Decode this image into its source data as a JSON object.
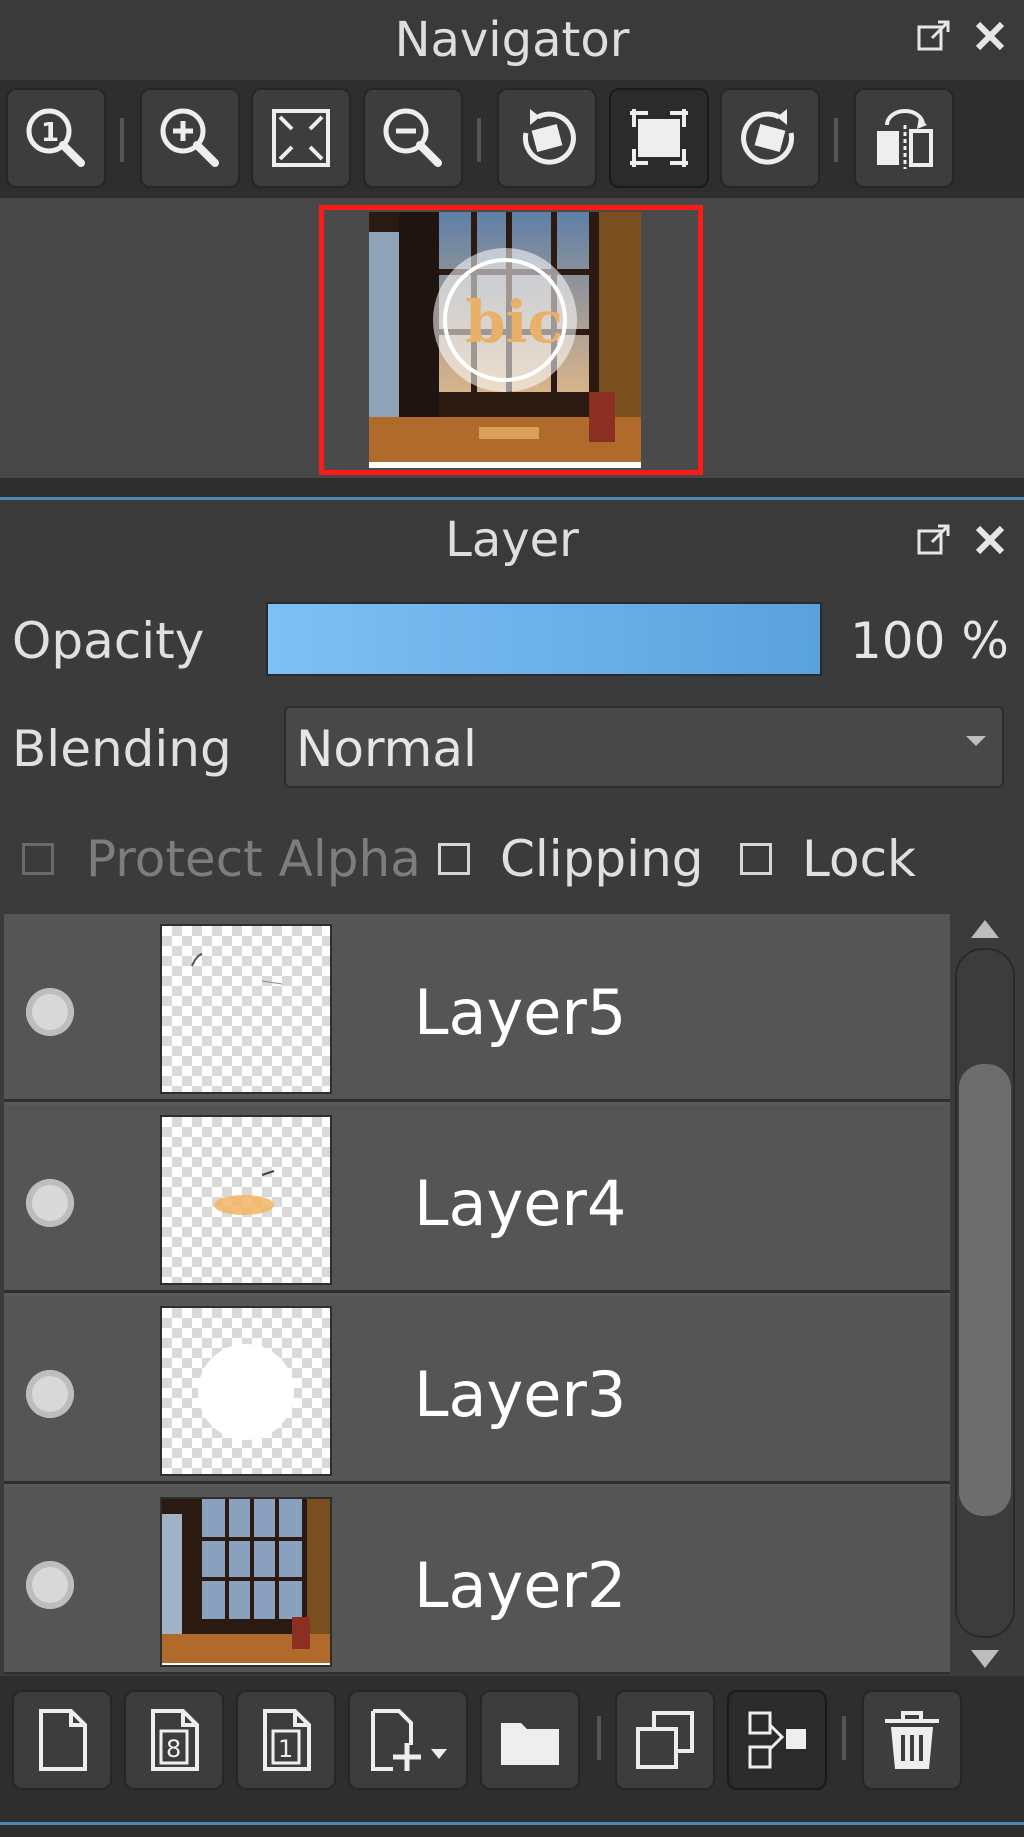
{
  "navigator": {
    "title": "Navigator",
    "toolbar": [
      "zoom-actual-icon",
      "zoom-in-icon",
      "fit-screen-icon",
      "zoom-out-icon",
      "rotate-left-icon",
      "fit-canvas-icon",
      "rotate-right-icon",
      "flip-horizontal-icon"
    ],
    "preview_text": "bic"
  },
  "layer_panel": {
    "title": "Layer",
    "opacity_label": "Opacity",
    "opacity_value": "100 %",
    "opacity_fraction": 1.0,
    "blending_label": "Blending",
    "blending_value": "Normal",
    "protect_alpha_label": "Protect Alpha",
    "clipping_label": "Clipping",
    "lock_label": "Lock",
    "layers": [
      {
        "name": "Layer5"
      },
      {
        "name": "Layer4"
      },
      {
        "name": "Layer3"
      },
      {
        "name": "Layer2"
      }
    ],
    "toolbar": [
      "new-layer-icon",
      "new-8bit-layer-icon",
      "new-1bit-layer-icon",
      "add-layer-menu-icon",
      "folder-icon",
      "duplicate-layer-icon",
      "merge-layer-icon",
      "delete-layer-icon"
    ]
  },
  "colors": {
    "accent": "#4d86b8",
    "selection_frame": "#ff1a1a",
    "opacity_bar": "#6fb2ea"
  }
}
